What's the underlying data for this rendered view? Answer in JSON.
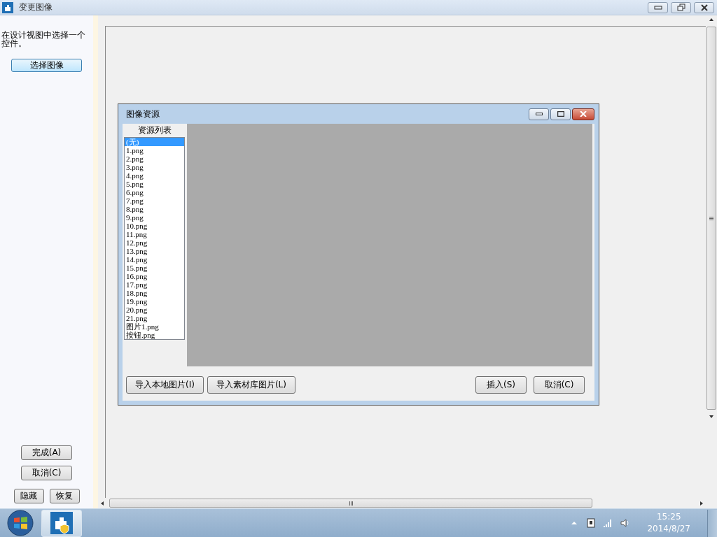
{
  "window": {
    "title": "变更图像"
  },
  "sidebar": {
    "hint": "在设计视图中选择一个控件。",
    "select_button": "选择图像",
    "buttons": [
      "完成(A)",
      "取消(C)"
    ],
    "small_buttons": [
      "隐藏",
      "恢复"
    ]
  },
  "dialog": {
    "title": "图像资源",
    "list_title": "资源列表",
    "items": [
      {
        "label": "(无)",
        "selected": true
      },
      {
        "label": "1.png",
        "selected": false
      },
      {
        "label": "2.png",
        "selected": false
      },
      {
        "label": "3.png",
        "selected": false
      },
      {
        "label": "4.png",
        "selected": false
      },
      {
        "label": "5.png",
        "selected": false
      },
      {
        "label": "6.png",
        "selected": false
      },
      {
        "label": "7.png",
        "selected": false
      },
      {
        "label": "8.png",
        "selected": false
      },
      {
        "label": "9.png",
        "selected": false
      },
      {
        "label": "10.png",
        "selected": false
      },
      {
        "label": "11.png",
        "selected": false
      },
      {
        "label": "12.png",
        "selected": false
      },
      {
        "label": "13.png",
        "selected": false
      },
      {
        "label": "14.png",
        "selected": false
      },
      {
        "label": "15.png",
        "selected": false
      },
      {
        "label": "16.png",
        "selected": false
      },
      {
        "label": "17.png",
        "selected": false
      },
      {
        "label": "18.png",
        "selected": false
      },
      {
        "label": "19.png",
        "selected": false
      },
      {
        "label": "20.png",
        "selected": false
      },
      {
        "label": "21.png",
        "selected": false
      },
      {
        "label": "图片1.png",
        "selected": false
      },
      {
        "label": "按钮.png",
        "selected": false
      }
    ],
    "buttons_left": [
      "导入本地图片(I)",
      "导入素材库图片(L)"
    ],
    "buttons_right": [
      "插入(S)",
      "取消(C)"
    ]
  },
  "taskbar": {
    "time": "15:25",
    "date": "2014/8/27"
  }
}
